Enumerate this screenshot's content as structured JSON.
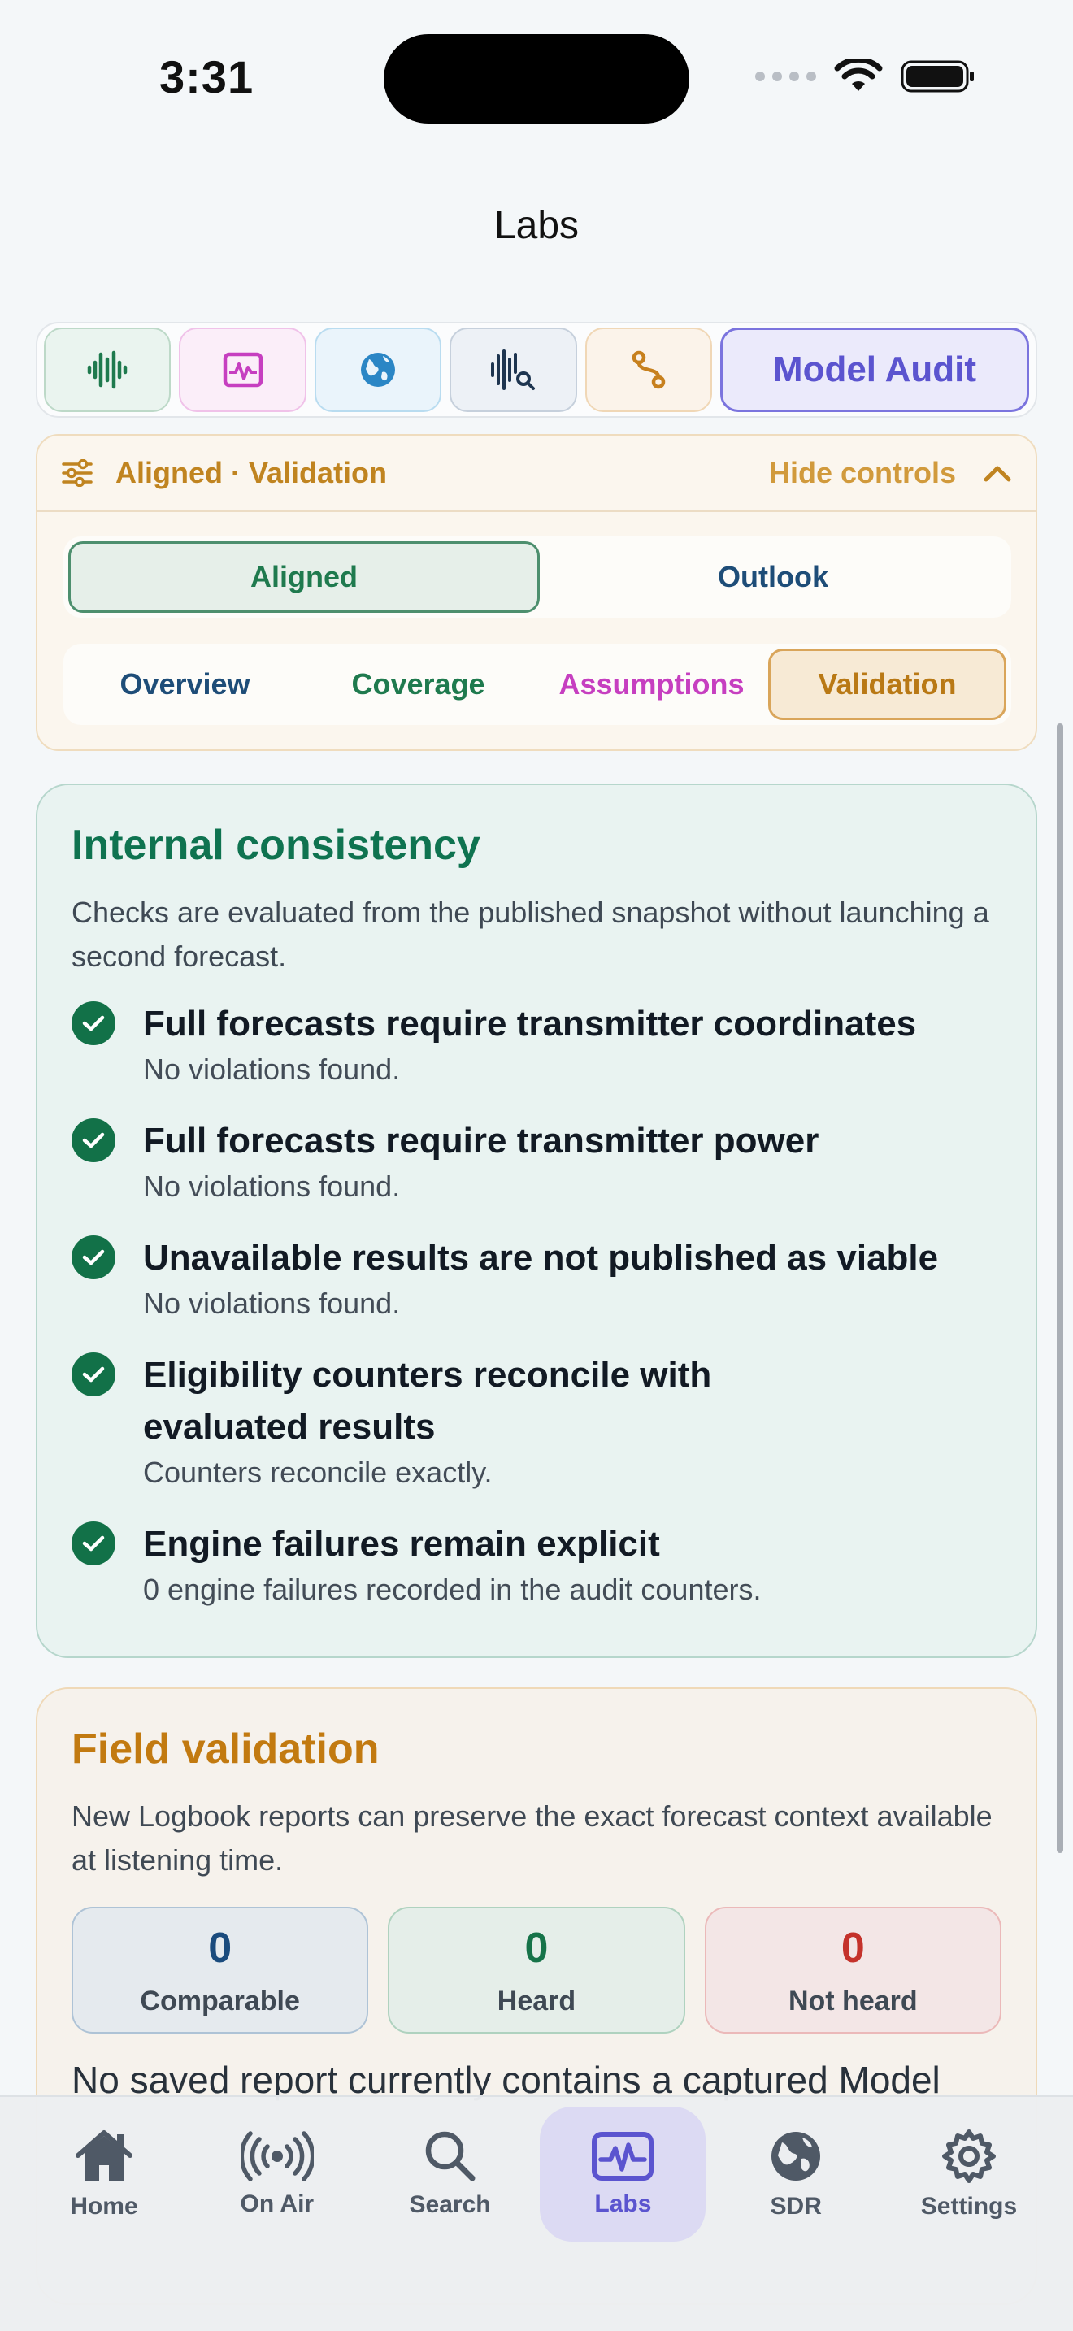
{
  "status_bar": {
    "time": "3:31"
  },
  "page": {
    "title": "Labs"
  },
  "toolbar": {
    "tools": [
      {
        "icon": "waveform-icon",
        "color": "#1f7a4e"
      },
      {
        "icon": "activity-monitor-icon",
        "color": "#c63fc0"
      },
      {
        "icon": "globe-icon",
        "color": "#2b86c5"
      },
      {
        "icon": "spectrum-search-icon",
        "color": "#1e3550"
      },
      {
        "icon": "route-icon",
        "color": "#c7801e"
      }
    ],
    "active_label": "Model Audit"
  },
  "controls": {
    "title": "Aligned · Validation",
    "hide_label": "Hide controls",
    "segments": [
      "Aligned",
      "Outlook"
    ],
    "selected_segment": "Aligned",
    "tabs": [
      "Overview",
      "Coverage",
      "Assumptions",
      "Validation"
    ],
    "selected_tab": "Validation"
  },
  "consistency": {
    "title": "Internal consistency",
    "description": "Checks are evaluated from the published snapshot without launching a second forecast.",
    "checks": [
      {
        "title": "Full forecasts require transmitter coordinates",
        "detail": "No violations found."
      },
      {
        "title": "Full forecasts require transmitter power",
        "detail": "No violations found."
      },
      {
        "title": "Unavailable results are not published as viable",
        "detail": "No violations found."
      },
      {
        "title": "Eligibility counters reconcile with evaluated results",
        "detail": "Counters reconcile exactly."
      },
      {
        "title": "Engine failures remain explicit",
        "detail": "0 engine failures recorded in the audit counters."
      }
    ]
  },
  "field_validation": {
    "title": "Field validation",
    "description": "New Logbook reports can preserve the exact forecast context available at listening time.",
    "stats": [
      {
        "value": "0",
        "label": "Comparable"
      },
      {
        "value": "0",
        "label": "Heard"
      },
      {
        "value": "0",
        "label": "Not heard"
      }
    ],
    "note": "No saved report currently contains a captured Model"
  },
  "tabbar": {
    "items": [
      {
        "label": "Home",
        "icon": "home-icon"
      },
      {
        "label": "On Air",
        "icon": "broadcast-icon"
      },
      {
        "label": "Search",
        "icon": "search-icon"
      },
      {
        "label": "Labs",
        "icon": "labs-icon"
      },
      {
        "label": "SDR",
        "icon": "globe-icon"
      },
      {
        "label": "Settings",
        "icon": "gear-icon"
      }
    ],
    "active": "Labs"
  }
}
